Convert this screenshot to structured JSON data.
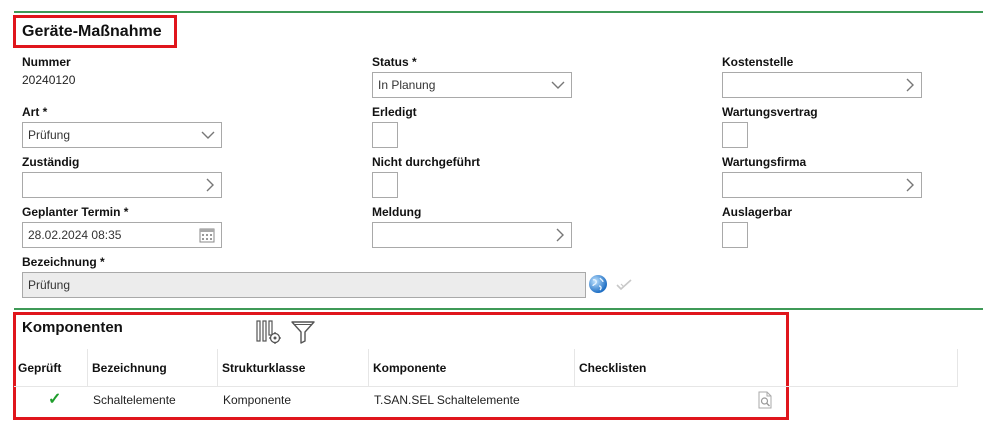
{
  "section1": {
    "title": "Geräte-Maßnahme",
    "nummer": {
      "label": "Nummer",
      "value": "20240120"
    },
    "status": {
      "label": "Status *",
      "value": "In Planung"
    },
    "kostenstelle": {
      "label": "Kostenstelle",
      "value": ""
    },
    "art": {
      "label": "Art *",
      "value": "Prüfung"
    },
    "erledigt": {
      "label": "Erledigt",
      "checked": false
    },
    "wartungsvertrag": {
      "label": "Wartungsvertrag",
      "checked": false
    },
    "zustaendig": {
      "label": "Zuständig",
      "value": ""
    },
    "nicht_durchgefuehrt": {
      "label": "Nicht durchgeführt",
      "checked": false
    },
    "wartungsfirma": {
      "label": "Wartungsfirma",
      "value": ""
    },
    "geplanter_termin": {
      "label": "Geplanter Termin *",
      "value": "28.02.2024 08:35"
    },
    "meldung": {
      "label": "Meldung",
      "value": ""
    },
    "auslagerbar": {
      "label": "Auslagerbar",
      "checked": false
    },
    "bezeichnung": {
      "label": "Bezeichnung *",
      "value": "Prüfung"
    }
  },
  "section2": {
    "title": "Komponenten",
    "columns": [
      "Geprüft",
      "Bezeichnung",
      "Strukturklasse",
      "Komponente",
      "Checklisten"
    ],
    "rows": [
      {
        "geprueft": "✓",
        "bezeichnung": "Schaltelemente",
        "strukturklasse": "Komponente",
        "komponente": "T.SAN.SEL Schaltelemente",
        "checklisten": ""
      }
    ]
  },
  "colors": {
    "accent_green": "#3f9a57",
    "highlight_red": "#e0161c",
    "check_green": "#1f9e2c"
  },
  "icons": [
    "chevron-down-icon",
    "chevron-right-icon",
    "calendar-icon",
    "globe-icon",
    "translate-check-icon",
    "column-settings-icon",
    "filter-icon",
    "checkmark-icon",
    "document-search-icon"
  ]
}
